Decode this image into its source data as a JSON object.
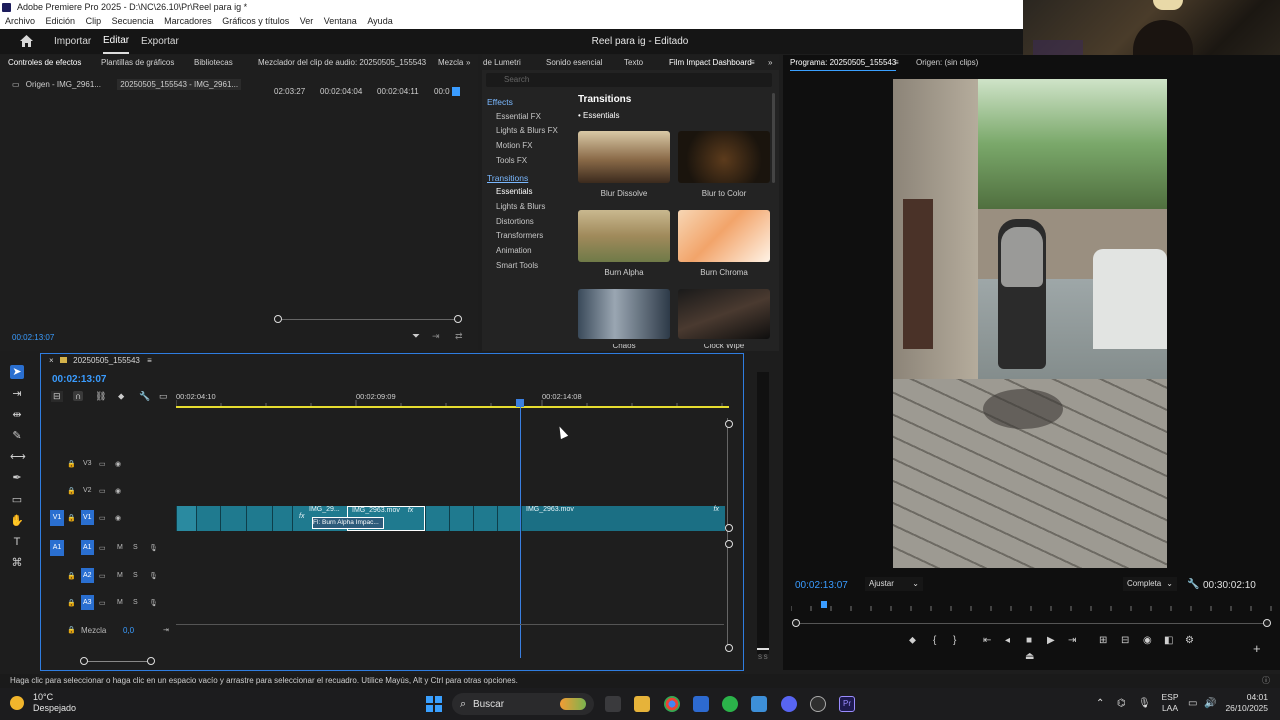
{
  "app": {
    "title": "Adobe Premiere Pro 2025 - D:\\NC\\26.10\\Pr\\Reel para ig *"
  },
  "menu": {
    "items": [
      "Archivo",
      "Edición",
      "Clip",
      "Secuencia",
      "Marcadores",
      "Gráficos y títulos",
      "Ver",
      "Ventana",
      "Ayuda"
    ]
  },
  "topnav": {
    "import": "Importar",
    "edit": "Editar",
    "export": "Exportar",
    "project": "Reel para ig - Editado"
  },
  "left_tabs": [
    "Controles de efectos",
    "Plantillas de gráficos",
    "Bibliotecas",
    "Mezclador del clip de audio: 20250505_155543",
    "Mezcla",
    "de Lumetri",
    "Sonido esencial",
    "Texto",
    "Film Impact Dashboard"
  ],
  "effect_controls": {
    "source_tab": "Origen - IMG_2961...",
    "seq_tab": "20250505_155543 - IMG_2961...",
    "ruler": [
      "02:03:27",
      "00:02:04:04",
      "00:02:04:11",
      "00:0"
    ],
    "timecode": "00:02:13:07"
  },
  "film_impact": {
    "search_placeholder": "Search",
    "effects_heading": "Effects",
    "effects": [
      "Essential FX",
      "Lights & Blurs FX",
      "Motion FX",
      "Tools FX"
    ],
    "transitions_heading": "Transitions",
    "transitions": [
      "Essentials",
      "Lights & Blurs",
      "Distortions",
      "Transformers",
      "Animation",
      "Smart Tools"
    ],
    "panel_title": "Transitions",
    "panel_subtitle": "• Essentials",
    "thumbs": [
      "Blur Dissolve",
      "Blur to Color",
      "Burn Alpha",
      "Burn Chroma",
      "Chaos",
      "Clock Wipe"
    ]
  },
  "program": {
    "tab": "Programa: 20250505_155543",
    "source_tab": "Origen: (sin clips)",
    "timecode": "00:02:13:07",
    "fit": "Ajustar",
    "quality": "Completa",
    "duration": "00:30:02:10"
  },
  "timeline": {
    "sequence": "20250505_155543",
    "timecode": "00:02:13:07",
    "ruler": [
      "00:02:04:10",
      "00:02:09:09",
      "00:02:14:08"
    ],
    "tracks_video": [
      "V3",
      "V2",
      "V1"
    ],
    "tracks_audio": [
      "A1",
      "A2",
      "A3"
    ],
    "source_patch": {
      "video": "V1",
      "audio": "A1"
    },
    "mix_label": "Mezcla",
    "mix_value": "0,0",
    "clips": [
      {
        "label": "IMG_29...",
        "fx": "fx"
      },
      {
        "label": "IMG_2963.mov",
        "fx": "fx"
      },
      {
        "label": "Fl: Burn Alpha Impac...",
        "fx": ""
      },
      {
        "label": "IMG_2963.mov",
        "fx": "fx"
      }
    ],
    "track_buttons": {
      "mute": "M",
      "solo": "S"
    }
  },
  "vu": {
    "scale": "S S"
  },
  "status": {
    "text": "Haga clic para seleccionar o haga clic en un espacio vacío y arrastre para seleccionar el recuadro. Utilice Mayús, Alt y Ctrl para otras opciones."
  },
  "taskbar": {
    "weather_temp": "10°C",
    "weather_desc": "Despejado",
    "search": "Buscar",
    "lang_top": "ESP",
    "lang_bottom": "LAA",
    "time": "04:01",
    "date": "26/10/2025"
  },
  "colors": {
    "accent": "#3a9cff",
    "timeline_border": "#2f7de0",
    "clip": "#1f7a8f",
    "work_area": "#e6dd30"
  }
}
